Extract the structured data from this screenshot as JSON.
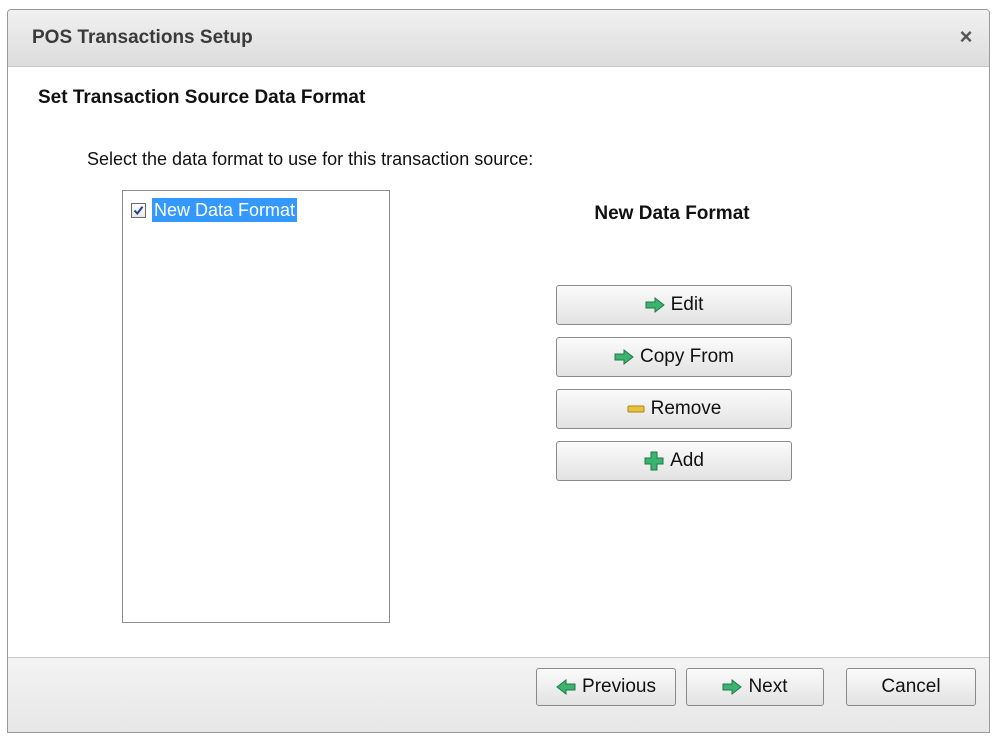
{
  "window": {
    "title": "POS Transactions Setup",
    "close_label": "×"
  },
  "content": {
    "heading": "Set Transaction Source Data Format",
    "instruction": "Select the data format to use for this transaction source:",
    "formats": [
      {
        "label": "New Data Format",
        "checked": true,
        "selected": true
      }
    ],
    "selected_format_name": "New Data Format"
  },
  "actions": {
    "edit": {
      "label": "Edit",
      "icon": "green-arrow-right-icon"
    },
    "copy_from": {
      "label": "Copy From",
      "icon": "green-arrow-right-icon"
    },
    "remove": {
      "label": "Remove",
      "icon": "yellow-minus-icon"
    },
    "add": {
      "label": "Add",
      "icon": "green-plus-icon"
    }
  },
  "footer": {
    "previous": {
      "label": "Previous",
      "icon": "green-arrow-left-icon"
    },
    "next": {
      "label": "Next",
      "icon": "green-arrow-right-icon"
    },
    "cancel": {
      "label": "Cancel"
    }
  },
  "colors": {
    "selection": "#3399ff",
    "arrow_green": "#3cb371",
    "minus_yellow": "#e8c23a"
  }
}
